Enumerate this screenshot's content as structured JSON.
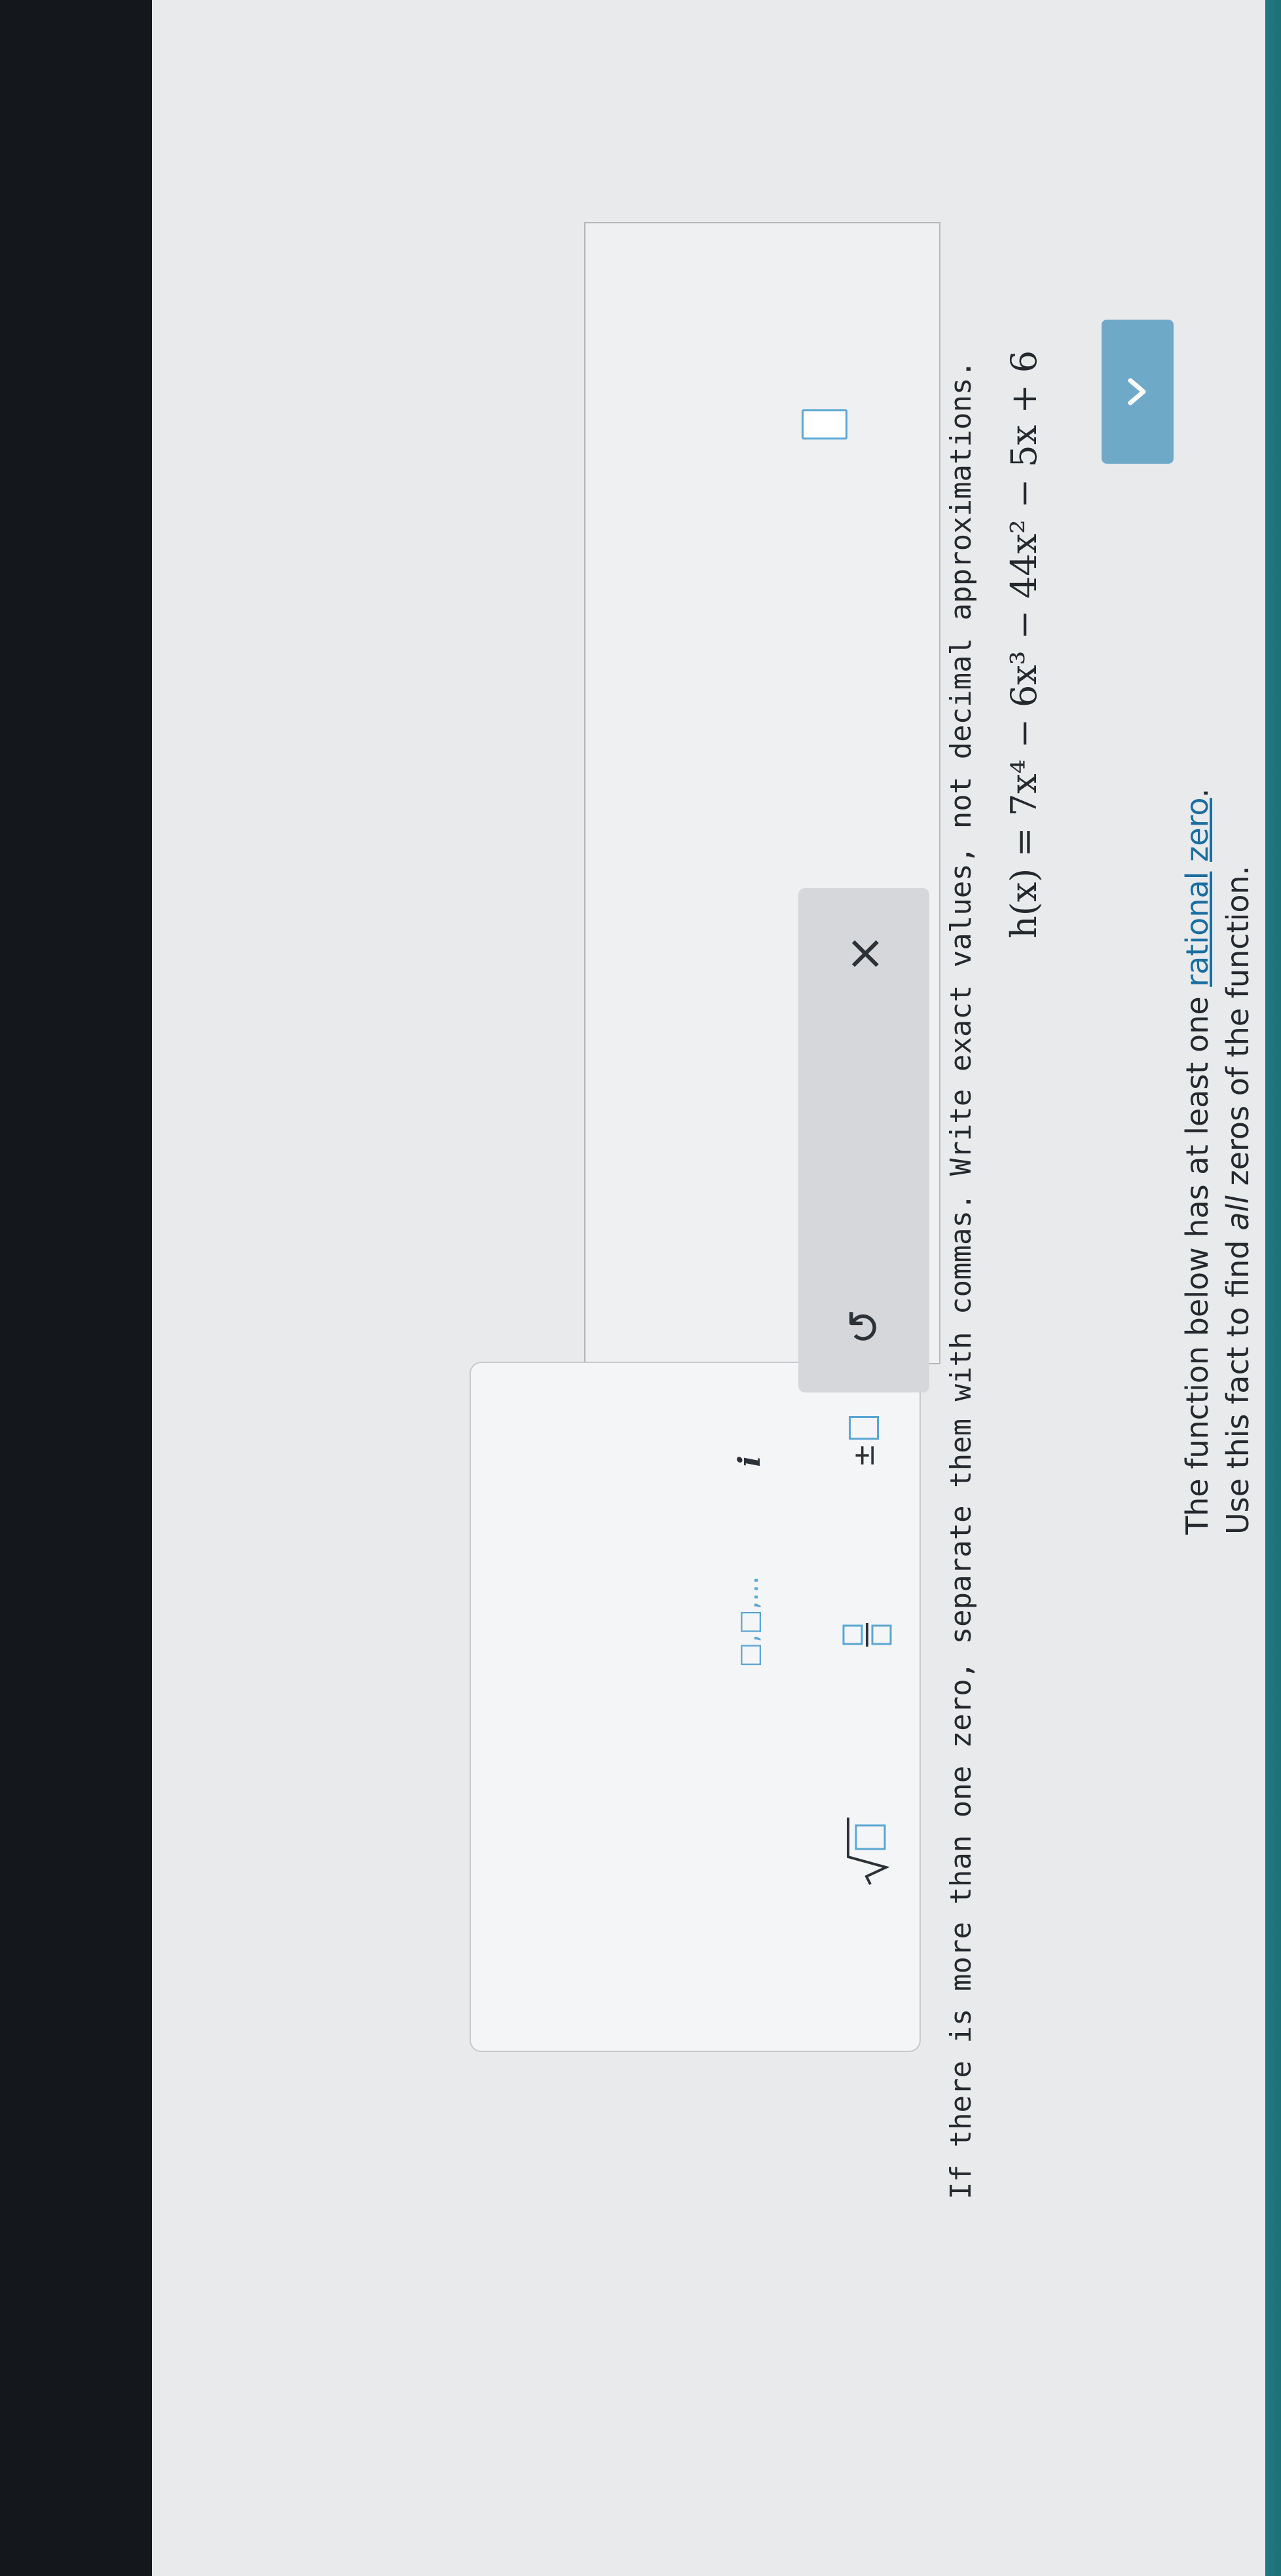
{
  "question": {
    "line1_pre": "The function below has at least one ",
    "link1": "rational",
    "link2": "zero",
    "line1_post": ".",
    "line2_pre": "Use this fact to find ",
    "line2_em": "all",
    "line2_post": " zeros of the function."
  },
  "equation": "h(x) = 7x⁴ − 6x³ − 44x² − 5x + 6",
  "instruction": "If there is more than one zero, separate them with commas. Write exact values, not decimal approximations.",
  "palette": {
    "plus_minus": "±",
    "imaginary": "i",
    "list": "□,□,...",
    "clear": "×",
    "undo": "↺"
  },
  "colors": {
    "accent": "#5aa6d4",
    "link": "#1a6ea0",
    "tab": "#6fa9c8"
  }
}
